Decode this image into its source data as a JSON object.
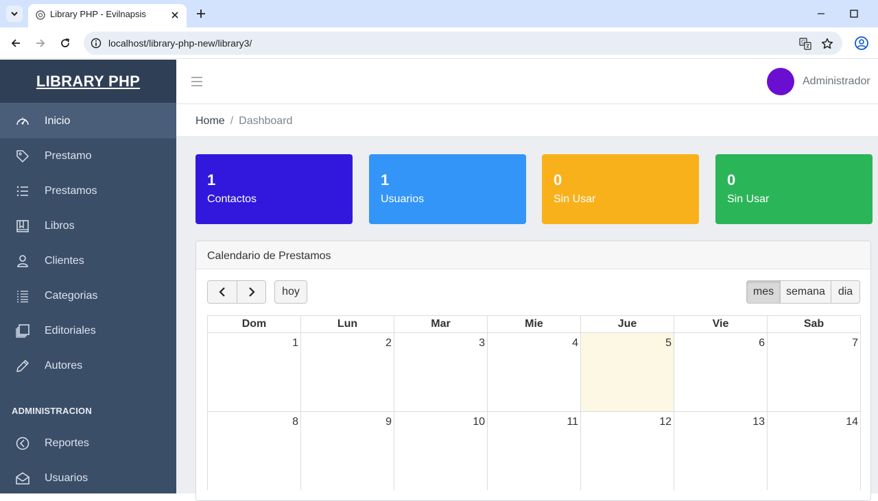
{
  "browser": {
    "tab_title": "Library PHP - Evilnapsis",
    "url": "localhost/library-php-new/library3/"
  },
  "sidebar": {
    "brand": "LIBRARY PHP",
    "items": [
      {
        "label": "Inicio",
        "icon": "dashboard-gauge-icon"
      },
      {
        "label": "Prestamo",
        "icon": "tag-icon"
      },
      {
        "label": "Prestamos",
        "icon": "list-icon"
      },
      {
        "label": "Libros",
        "icon": "book-icon"
      },
      {
        "label": "Clientes",
        "icon": "person-icon"
      },
      {
        "label": "Categorias",
        "icon": "list-details-icon"
      },
      {
        "label": "Editoriales",
        "icon": "collection-icon"
      },
      {
        "label": "Autores",
        "icon": "pencil-icon"
      }
    ],
    "admin_title": "ADMINISTRACION",
    "admin_items": [
      {
        "label": "Reportes",
        "icon": "chart-clock-icon"
      },
      {
        "label": "Usuarios",
        "icon": "envelope-open-icon"
      }
    ]
  },
  "header": {
    "username": "Administrador",
    "avatar_color": "#6a0fd1"
  },
  "breadcrumb": {
    "home": "Home",
    "separator": "/",
    "current": "Dashboard"
  },
  "stats": [
    {
      "value": "1",
      "label": "Contactos",
      "color": "#3118dc"
    },
    {
      "value": "1",
      "label": "Usuarios",
      "color": "#3395f7"
    },
    {
      "value": "0",
      "label": "Sin Usar",
      "color": "#f9b11b"
    },
    {
      "value": "0",
      "label": "Sin Usar",
      "color": "#2bb559"
    }
  ],
  "calendar": {
    "title": "Calendario de Prestamos",
    "today_label": "hoy",
    "views": [
      "mes",
      "semana",
      "dia"
    ],
    "active_view": "mes",
    "weekdays": [
      "Dom",
      "Lun",
      "Mar",
      "Mie",
      "Jue",
      "Vie",
      "Sab"
    ],
    "weeks": [
      [
        "1",
        "2",
        "3",
        "4",
        "5",
        "6",
        "7"
      ],
      [
        "8",
        "9",
        "10",
        "11",
        "12",
        "13",
        "14"
      ]
    ],
    "today": "5"
  }
}
